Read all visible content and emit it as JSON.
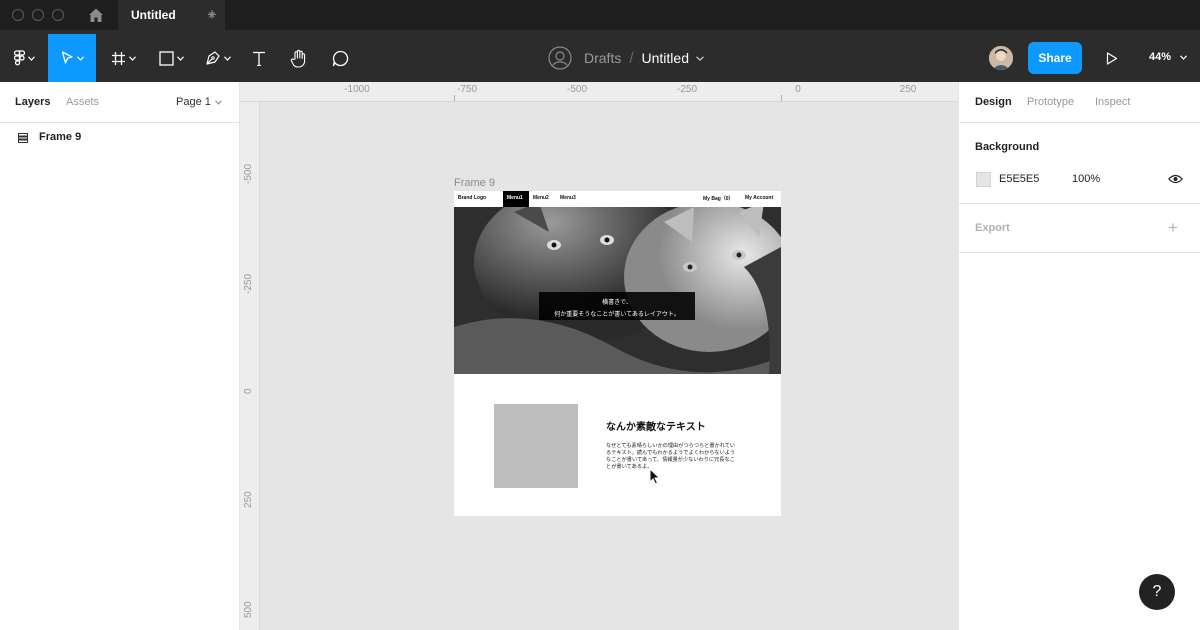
{
  "tabbar": {
    "tab_title": "Untitled",
    "close_glyph": "×",
    "add_glyph": "+"
  },
  "toolbar": {
    "breadcrumb_parent": "Drafts",
    "breadcrumb_sep": "/",
    "file_title": "Untitled",
    "share_label": "Share",
    "zoom": "44%",
    "active_tool": "move-tool",
    "accent_color": "#0d99ff"
  },
  "left_panel": {
    "tabs": [
      "Layers",
      "Assets"
    ],
    "page_select": "Page 1",
    "layers": [
      {
        "label": "Frame 9",
        "icon": "frame-layer-icon"
      }
    ]
  },
  "canvas": {
    "ruler_top": [
      "-1000",
      "-750",
      "-500",
      "-250",
      "0",
      "250"
    ],
    "ruler_left": [
      "-500",
      "-250",
      "0",
      "250",
      "500"
    ],
    "frame_label": "Frame 9"
  },
  "mock_site": {
    "brand": "Brand Logo",
    "menu": [
      "Menu1",
      "Menu2",
      "Menu3"
    ],
    "bag": "My Bag（0）",
    "account": "My Account",
    "hero_caption_line1": "横書きで、",
    "hero_caption_line2": "何か重要そうなことが書いてあるレイアウト。",
    "feature_title": "なんか素敵なテキスト",
    "feature_body": "なぜとても素晴らしいかの理由がつらつらと書かれているテキスト。読んでもわかるようでよくわからないようなことが書いてあって、情報量が少ないわりに冗長なことが書いてあるよ。"
  },
  "right_panel": {
    "tabs": [
      "Design",
      "Prototype",
      "Inspect"
    ],
    "background_title": "Background",
    "background_hex": "E5E5E5",
    "background_opacity": "100%",
    "export_title": "Export",
    "export_add": "+"
  },
  "help_label": "?"
}
